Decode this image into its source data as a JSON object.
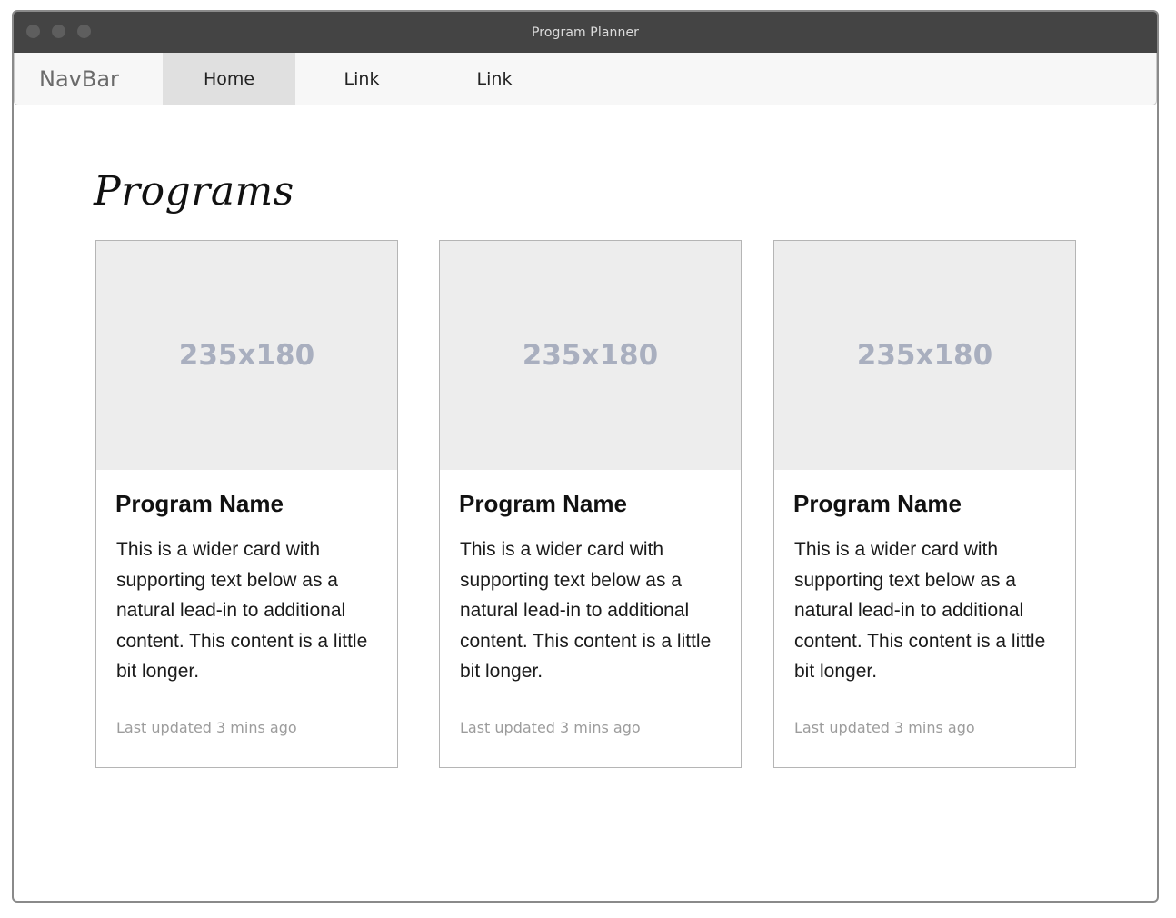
{
  "window": {
    "title": "Program Planner"
  },
  "navbar": {
    "brand": "NavBar",
    "items": [
      {
        "label": "Home",
        "active": true
      },
      {
        "label": "Link",
        "active": false
      },
      {
        "label": "Link",
        "active": false
      }
    ]
  },
  "main": {
    "heading": "Programs",
    "cards": [
      {
        "image_placeholder": "235x180",
        "title": "Program Name",
        "text": "This is a wider card with supporting text below as a natural lead-in to additional content. This content is a little bit longer.",
        "footer": "Last updated 3 mins ago"
      },
      {
        "image_placeholder": "235x180",
        "title": "Program Name",
        "text": "This is a wider card with supporting text below as a natural lead-in to additional content. This content is a little bit longer.",
        "footer": "Last updated 3 mins ago"
      },
      {
        "image_placeholder": "235x180",
        "title": "Program Name",
        "text": "This is a wider card with supporting text below as a natural lead-in to additional content. This content is a little bit longer.",
        "footer": "Last updated 3 mins ago"
      }
    ]
  },
  "colors": {
    "titlebar": "#444444",
    "navbar_bg": "#f7f7f7",
    "nav_active_bg": "#e0e0e0",
    "image_placeholder_bg": "#ededed",
    "image_placeholder_text": "#a9afbf"
  }
}
